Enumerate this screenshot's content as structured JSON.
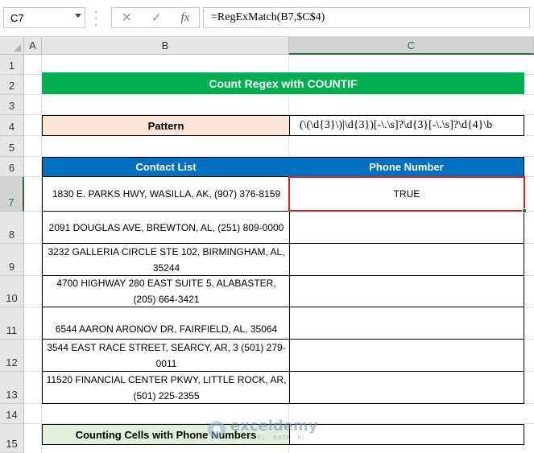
{
  "name_box": "C7",
  "formula_bar": {
    "cancel_icon": "✕",
    "enter_icon": "✓",
    "fx_label": "fx",
    "formula": "=RegExMatch(B7,$C$4)"
  },
  "columns": [
    "A",
    "B",
    "C"
  ],
  "rows": [
    "1",
    "2",
    "3",
    "4",
    "5",
    "6",
    "7",
    "8",
    "9",
    "10",
    "11",
    "12",
    "13",
    "14",
    "15"
  ],
  "selected": {
    "column": "C",
    "row": "7"
  },
  "sheet": {
    "title": "Count Regex with COUNTIF",
    "pattern_label": "Pattern",
    "pattern_value": "(\\(\\d{3}\\)|\\d{3})[-\\.\\s]?\\d{3}[-\\.\\s]?\\d{4}\\b",
    "headers": {
      "contact": "Contact List",
      "phone": "Phone Number"
    },
    "contacts": [
      {
        "address": "1830 E. PARKS HWY, WASILLA, AK, (907) 376-8159",
        "result": "TRUE"
      },
      {
        "address": "2091 DOUGLAS AVE, BREWTON, AL, (251) 809-0000",
        "result": ""
      },
      {
        "address": "3232 GALLERIA CIRCLE STE 102, BIRMINGHAM, AL, 35244",
        "result": ""
      },
      {
        "address": "4700 HIGHWAY 280 EAST SUITE 5, ALABASTER, (205) 664-3421",
        "result": ""
      },
      {
        "address": "6544 AARON ARONOV DR, FAIRFIELD, AL, 35064",
        "result": ""
      },
      {
        "address": "3544 EAST RACE STREET, SEARCY, AR, 3 (501) 279-0011",
        "result": ""
      },
      {
        "address": "11520 FINANCIAL CENTER PKWY, LITTLE ROCK, AR, (501) 225-2355",
        "result": ""
      }
    ],
    "count_label": "Counting Cells with Phone Numbers",
    "count_value": ""
  },
  "watermark": {
    "name": "exceldemy",
    "tagline": "EXCEL · DATA · BI"
  },
  "colors": {
    "title_bg": "#00b050",
    "header_bg": "#0070c0",
    "pattern_bg": "#fce4d6",
    "count_bg": "#e2efda",
    "active_border": "#e11d1d"
  }
}
